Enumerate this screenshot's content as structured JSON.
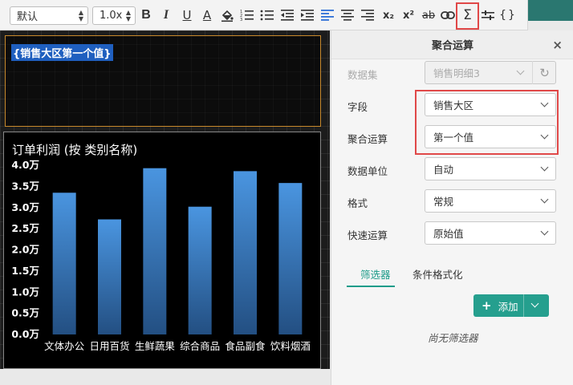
{
  "toolbar": {
    "font_family": "默认",
    "font_size": "1.0x",
    "bold": "B",
    "italic": "I",
    "underline": "U",
    "font_color": "A",
    "subscript": "x₂",
    "superscript": "x²",
    "strikethrough": "ab",
    "aggregate": "Σ",
    "braces": "{}"
  },
  "canvas": {
    "text_field": "{销售大区第一个值}"
  },
  "panel": {
    "title": "聚合运算",
    "close": "×",
    "rows": [
      {
        "label": "数据集",
        "value": "销售明细3"
      },
      {
        "label": "字段",
        "value": "销售大区"
      },
      {
        "label": "聚合运算",
        "value": "第一个值"
      },
      {
        "label": "数据单位",
        "value": "自动"
      },
      {
        "label": "格式",
        "value": "常规"
      },
      {
        "label": "快速运算",
        "value": "原始值"
      }
    ],
    "refresh": "↻",
    "tabs": [
      "筛选器",
      "条件格式化"
    ],
    "add_plus": "+",
    "add_label": "添加",
    "empty_filter": "尚无筛选器"
  },
  "chart_data": {
    "type": "bar",
    "title": "订单利润 (按 类别名称)",
    "categories": [
      "文体办公",
      "日用百货",
      "生鲜蔬果",
      "综合商品",
      "食品副食",
      "饮料烟酒"
    ],
    "values": [
      3.35,
      2.72,
      3.93,
      3.02,
      3.86,
      3.58
    ],
    "yticks": [
      "0.0万",
      "0.5万",
      "1.0万",
      "1.5万",
      "2.0万",
      "2.5万",
      "3.0万",
      "3.5万",
      "4.0万"
    ],
    "ylim": [
      0,
      4.0
    ],
    "bar_color": "#4a95e0"
  }
}
